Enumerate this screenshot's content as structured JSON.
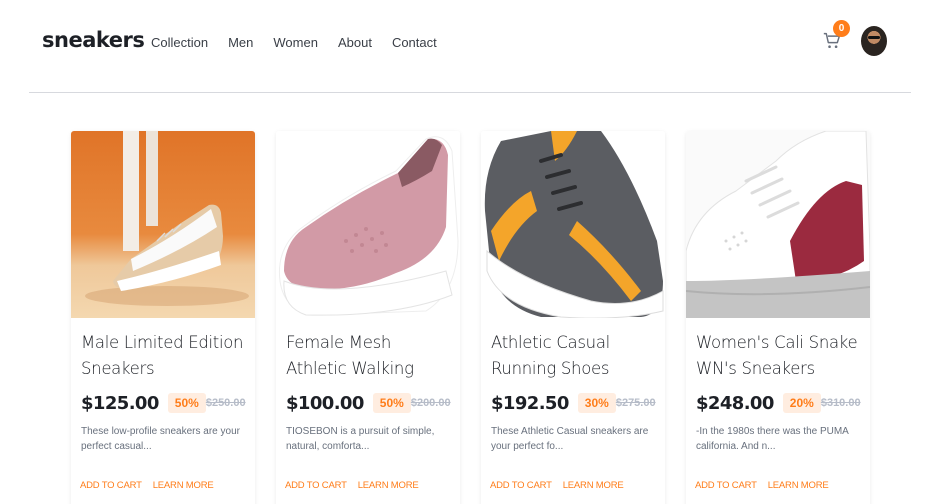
{
  "header": {
    "logo": "sneakers",
    "nav": [
      "Collection",
      "Men",
      "Women",
      "About",
      "Contact"
    ],
    "cart_count": "0"
  },
  "products": [
    {
      "title": "Male Limited Edition Sneakers",
      "price": "$125.00",
      "discount": "50%",
      "old_price": "$250.00",
      "desc": "These low-profile sneakers are your perfect casual...",
      "add_label": "ADD TO CART",
      "learn_label": "LEARN MORE"
    },
    {
      "title": "Female Mesh Athletic Walking",
      "price": "$100.00",
      "discount": "50%",
      "old_price": "$200.00",
      "desc": "TIOSEBON is a pursuit of simple, natural, comforta...",
      "add_label": "ADD TO CART",
      "learn_label": "LEARN MORE"
    },
    {
      "title": "Athletic Casual Running Shoes",
      "price": "$192.50",
      "discount": "30%",
      "old_price": "$275.00",
      "desc": "These Athletic Casual sneakers are your perfect fo...",
      "add_label": "ADD TO CART",
      "learn_label": "LEARN MORE"
    },
    {
      "title": "Women's Cali Snake WN's Sneakers",
      "price": "$248.00",
      "discount": "20%",
      "old_price": "$310.00",
      "desc": "-In the 1980s there was the PUMA california. And n...",
      "add_label": "ADD TO CART",
      "learn_label": "LEARN MORE"
    }
  ],
  "colors": {
    "accent": "#ff7d1a",
    "accent_light": "#ffede0",
    "text_dark": "#1d2026",
    "text_muted": "#68707d"
  },
  "icons": {
    "cart": "cart-icon",
    "avatar": "avatar"
  }
}
